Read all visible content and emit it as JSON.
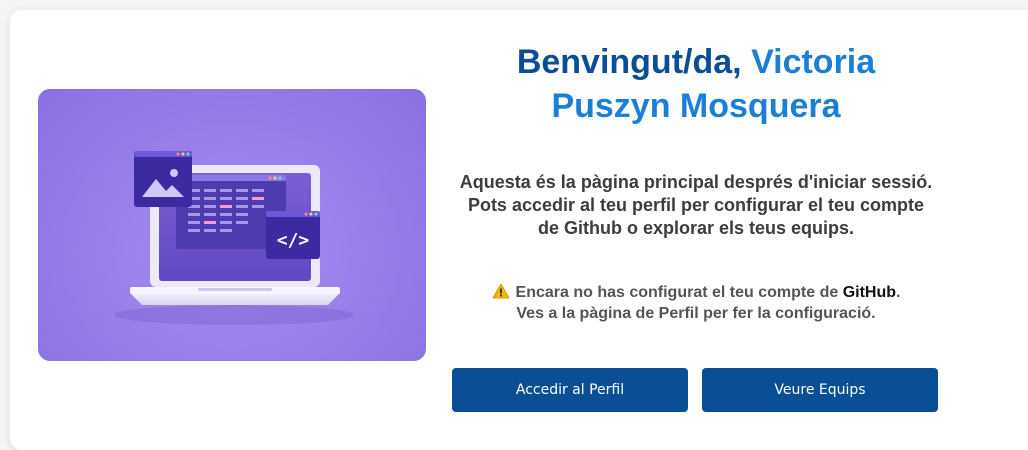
{
  "welcome": {
    "greeting": "Benvingut/da,",
    "user_first_name": "Victoria",
    "user_last_name": "Puszyn Mosquera"
  },
  "description": "Aquesta és la pàgina principal després d'iniciar sessió. Pots accedir al teu perfil per configurar el teu compte de Github o explorar els teus equips.",
  "warning": {
    "icon": "warning-icon",
    "text_before": "Encara no has configurat el teu compte de ",
    "highlight": "GitHub",
    "text_after": ".",
    "line2": "Ves a la pàgina de Perfil per fer la configuració."
  },
  "buttons": {
    "profile_label": "Accedir al Perfil",
    "teams_label": "Veure Equips"
  },
  "colors": {
    "primary": "#0a4e96",
    "accent": "#1a7fd8",
    "hero_bg": "#9a80ea"
  }
}
